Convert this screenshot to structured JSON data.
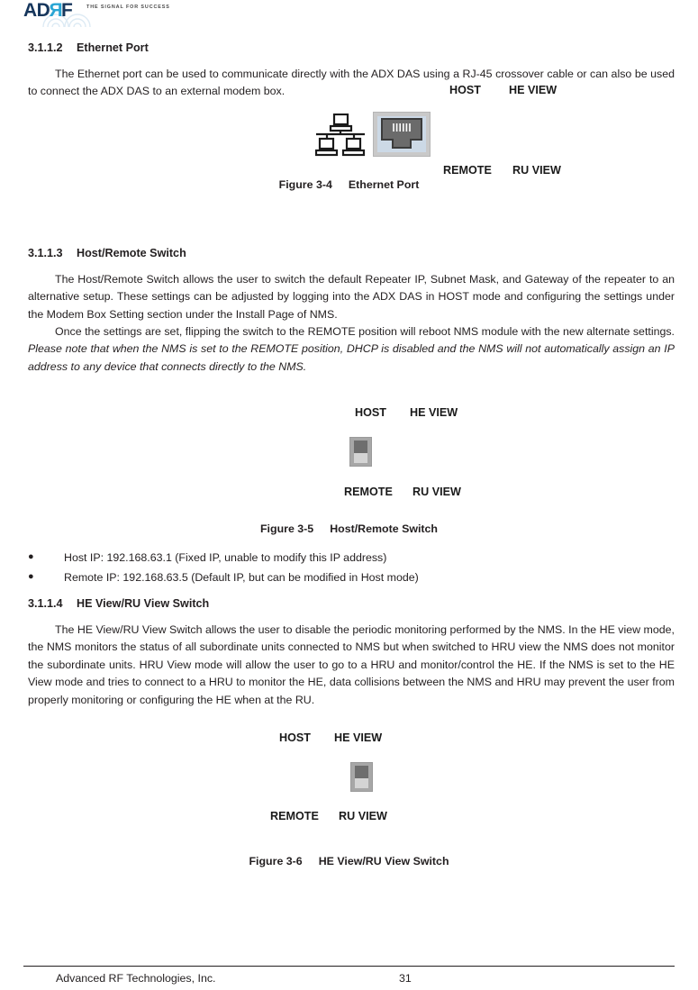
{
  "header": {
    "logo_text_ad": "AD",
    "logo_text_r": "R",
    "logo_text_f": "F",
    "tagline": "THE SIGNAL FOR SUCCESS",
    "brand_navy": "#16365c",
    "brand_cyan": "#29a5d4"
  },
  "sections": {
    "ethernet": {
      "number": "3.1.1.2",
      "title": "Ethernet Port",
      "body": "The Ethernet port can be used to communicate directly with the ADX DAS using a RJ-45 crossover cable or can also be used to connect the ADX DAS to an external modem box.",
      "figure_number": "Figure 3-4",
      "figure_title": "Ethernet Port"
    },
    "host_remote": {
      "number": "3.1.1.3",
      "title": "Host/Remote Switch",
      "body_p1": "The Host/Remote Switch allows the user to switch the default Repeater IP, Subnet Mask, and Gateway of the repeater to an alternative setup.  These settings can be adjusted by logging into the ADX DAS in HOST mode and configuring the settings under the Modem Box Setting section under the Install Page of NMS.",
      "body_p2_plain": "Once the settings are set, flipping the switch to the REMOTE position will reboot NMS module with the new alternate settings.  ",
      "body_p2_italic": "Please note that when the NMS is set to the REMOTE position, DHCP is disabled and the NMS will not automatically assign an IP address to any device that connects directly to the NMS.",
      "figure_number": "Figure 3-5",
      "figure_title": "Host/Remote Switch",
      "bullets": [
        "Host IP: 192.168.63.1 (Fixed IP, unable to modify this IP address)",
        "Remote IP: 192.168.63.5 (Default IP, but can be modified in Host mode)"
      ]
    },
    "he_ru": {
      "number": "3.1.1.4",
      "title": "HE View/RU View Switch",
      "body": "The HE View/RU View Switch allows the user to disable the periodic monitoring performed by the NMS.  In the HE view mode, the NMS monitors the status of all subordinate units connected to NMS but when switched to HRU view the NMS does not monitor the subordinate units.  HRU View mode will allow the user to go to a HRU and monitor/control the HE.  If the NMS is set to the HE View mode and tries to connect to a HRU to monitor the HE, data collisions between the NMS and HRU may prevent the user from properly monitoring or configuring the HE when at the RU.",
      "figure_number": "Figure 3-6",
      "figure_title": "HE View/RU View Switch"
    }
  },
  "switch_labels": {
    "host": "HOST",
    "he_view": "HE VIEW",
    "remote": "REMOTE",
    "ru_view": "RU VIEW"
  },
  "footer": {
    "company": "Advanced RF Technologies, Inc.",
    "page_number": "31"
  }
}
